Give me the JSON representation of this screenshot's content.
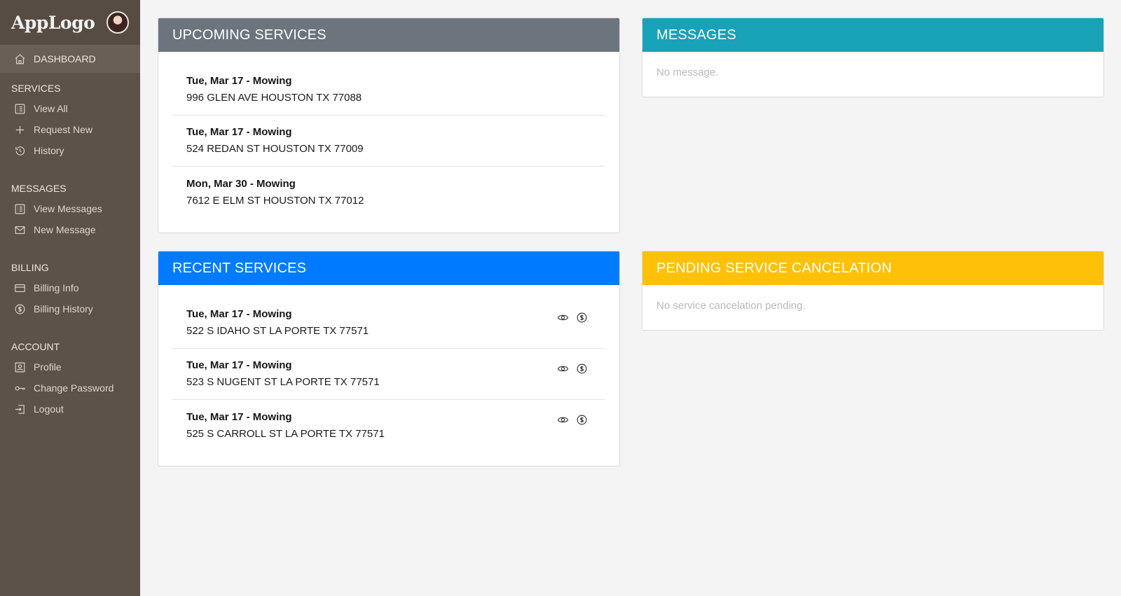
{
  "sidebar": {
    "logo": "AppLogo",
    "dashboard": {
      "label": "DASHBOARD",
      "icon": "home-icon"
    },
    "sections": [
      {
        "title": "SERVICES",
        "items": [
          {
            "label": "View All",
            "icon": "list-icon"
          },
          {
            "label": "Request New",
            "icon": "plus-icon"
          },
          {
            "label": "History",
            "icon": "history-icon"
          }
        ]
      },
      {
        "title": "MESSAGES",
        "items": [
          {
            "label": "View Messages",
            "icon": "list-icon"
          },
          {
            "label": "New Message",
            "icon": "envelope-icon"
          }
        ]
      },
      {
        "title": "BILLING",
        "items": [
          {
            "label": "Billing Info",
            "icon": "credit-card-icon"
          },
          {
            "label": "Billing History",
            "icon": "dollar-circle-icon"
          }
        ]
      },
      {
        "title": "ACCOUNT",
        "items": [
          {
            "label": "Profile",
            "icon": "profile-icon"
          },
          {
            "label": "Change Password",
            "icon": "key-icon"
          },
          {
            "label": "Logout",
            "icon": "logout-icon"
          }
        ]
      }
    ]
  },
  "upcoming": {
    "title": "UPCOMING SERVICES",
    "items": [
      {
        "title": "Tue, Mar 17 - Mowing",
        "address": "996 GLEN AVE HOUSTON TX 77088"
      },
      {
        "title": "Tue, Mar 17 - Mowing",
        "address": "524 REDAN ST HOUSTON TX 77009"
      },
      {
        "title": "Mon, Mar 30 - Mowing",
        "address": "7612 E ELM ST HOUSTON TX 77012"
      }
    ]
  },
  "messages": {
    "title": "MESSAGES",
    "empty": "No message."
  },
  "recent": {
    "title": "RECENT SERVICES",
    "items": [
      {
        "title": "Tue, Mar 17 - Mowing",
        "address": "522 S IDAHO ST LA PORTE TX 77571"
      },
      {
        "title": "Tue, Mar 17 - Mowing",
        "address": "523 S NUGENT ST LA PORTE TX 77571"
      },
      {
        "title": "Tue, Mar 17 - Mowing",
        "address": "525 S CARROLL ST LA PORTE TX 77571"
      }
    ]
  },
  "cancelation": {
    "title": "PENDING SERVICE CANCELATION",
    "empty": "No service cancelation pending."
  },
  "colors": {
    "sidebar": "#5d5249",
    "gray_header": "#6c757d",
    "teal_header": "#17a2b8",
    "blue_header": "#007bff",
    "yellow_header": "#ffc107"
  }
}
